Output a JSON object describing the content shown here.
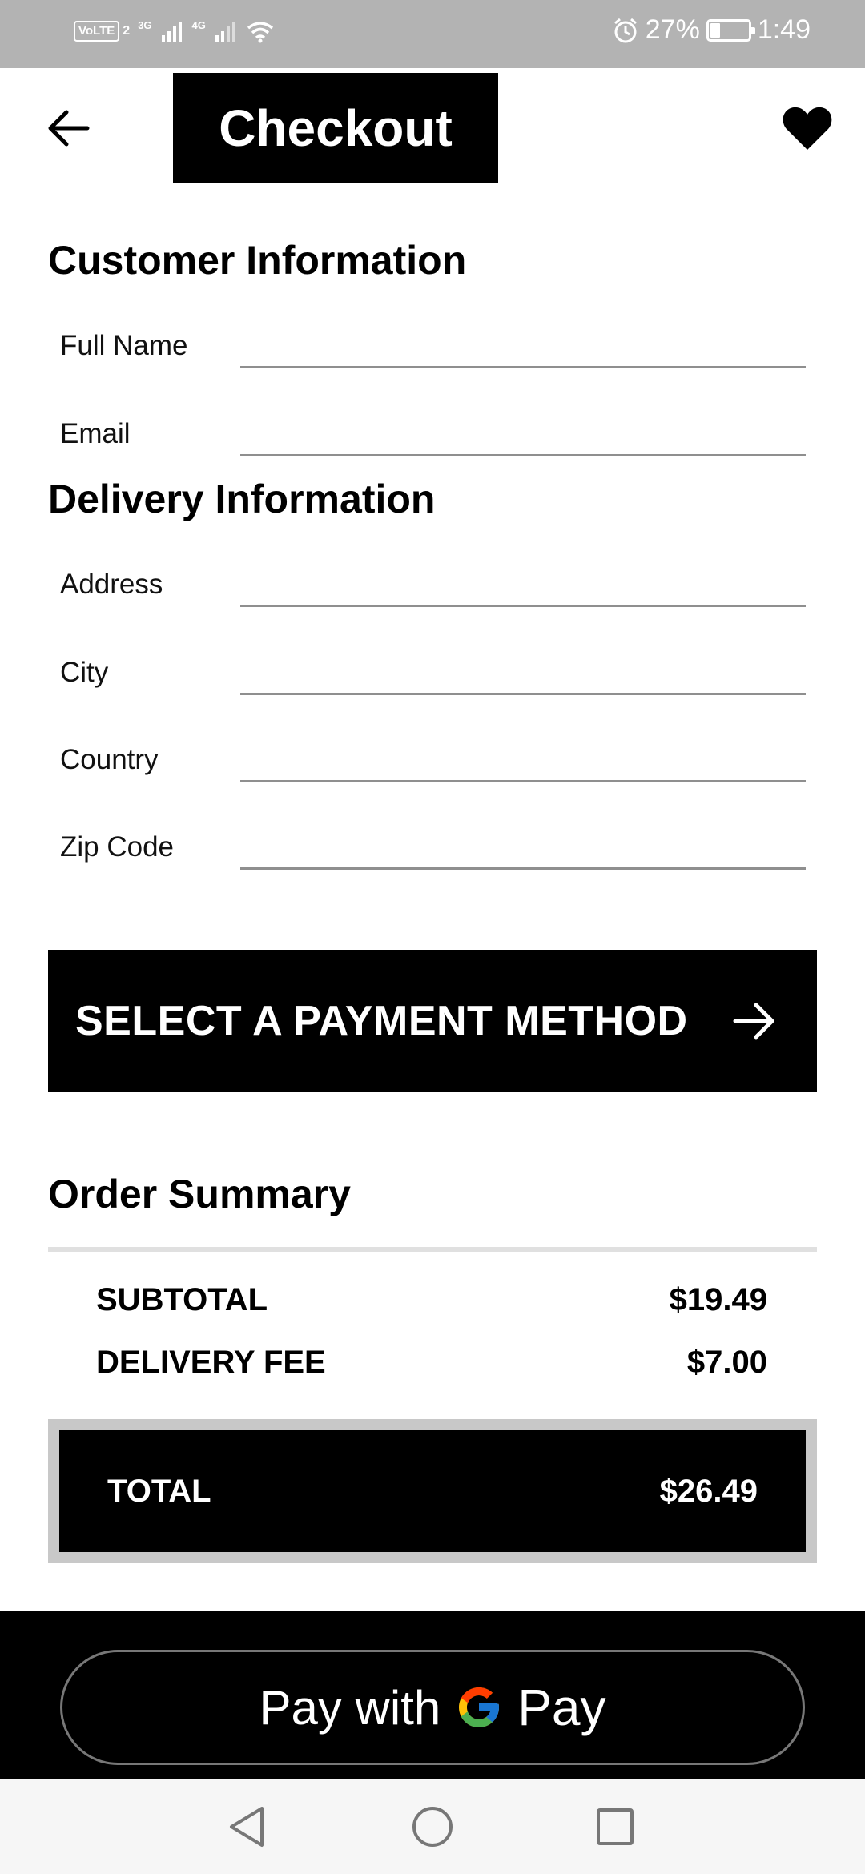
{
  "status_bar": {
    "volte": "VoLTE",
    "sim_number": "2",
    "net1": "3G",
    "net2": "4G",
    "battery_percent": "27%",
    "battery_level": 0.27,
    "time": "1:49"
  },
  "header": {
    "title": "Checkout",
    "back_icon": "arrow-left-icon",
    "favorite_icon": "heart-icon"
  },
  "customer_info": {
    "heading": "Customer Information",
    "fields": [
      {
        "label": "Full Name",
        "value": ""
      },
      {
        "label": "Email",
        "value": ""
      }
    ]
  },
  "delivery_info": {
    "heading": "Delivery Information",
    "fields": [
      {
        "label": "Address",
        "value": ""
      },
      {
        "label": "City",
        "value": ""
      },
      {
        "label": "Country",
        "value": ""
      },
      {
        "label": "Zip Code",
        "value": ""
      }
    ]
  },
  "payment_button": {
    "label": "SELECT A PAYMENT METHOD",
    "icon": "arrow-right-icon"
  },
  "order_summary": {
    "heading": "Order Summary",
    "subtotal_label": "SUBTOTAL",
    "subtotal_value": "$19.49",
    "delivery_label": "DELIVERY FEE",
    "delivery_value": "$7.00",
    "total_label": "TOTAL",
    "total_value": "$26.49"
  },
  "gpay": {
    "prefix": "Pay with",
    "brand": "Pay",
    "icon": "google-g-icon"
  },
  "colors": {
    "primary": "#000000",
    "status_bar": "#b3b3b3",
    "divider": "#e0e0e0"
  }
}
